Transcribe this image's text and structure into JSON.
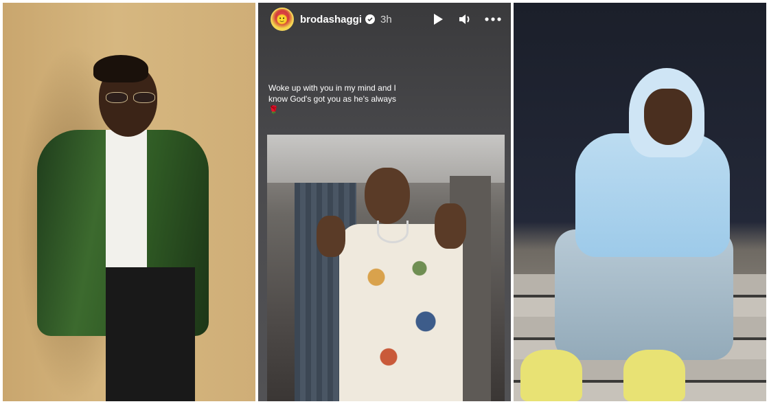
{
  "story": {
    "username": "brodashaggi",
    "time": "3h",
    "caption": "Woke up with you in my mind and I know God's got you as he's always 🌹",
    "icons": [
      "play-icon",
      "volume-icon",
      "more-icon",
      "verified-icon"
    ]
  }
}
